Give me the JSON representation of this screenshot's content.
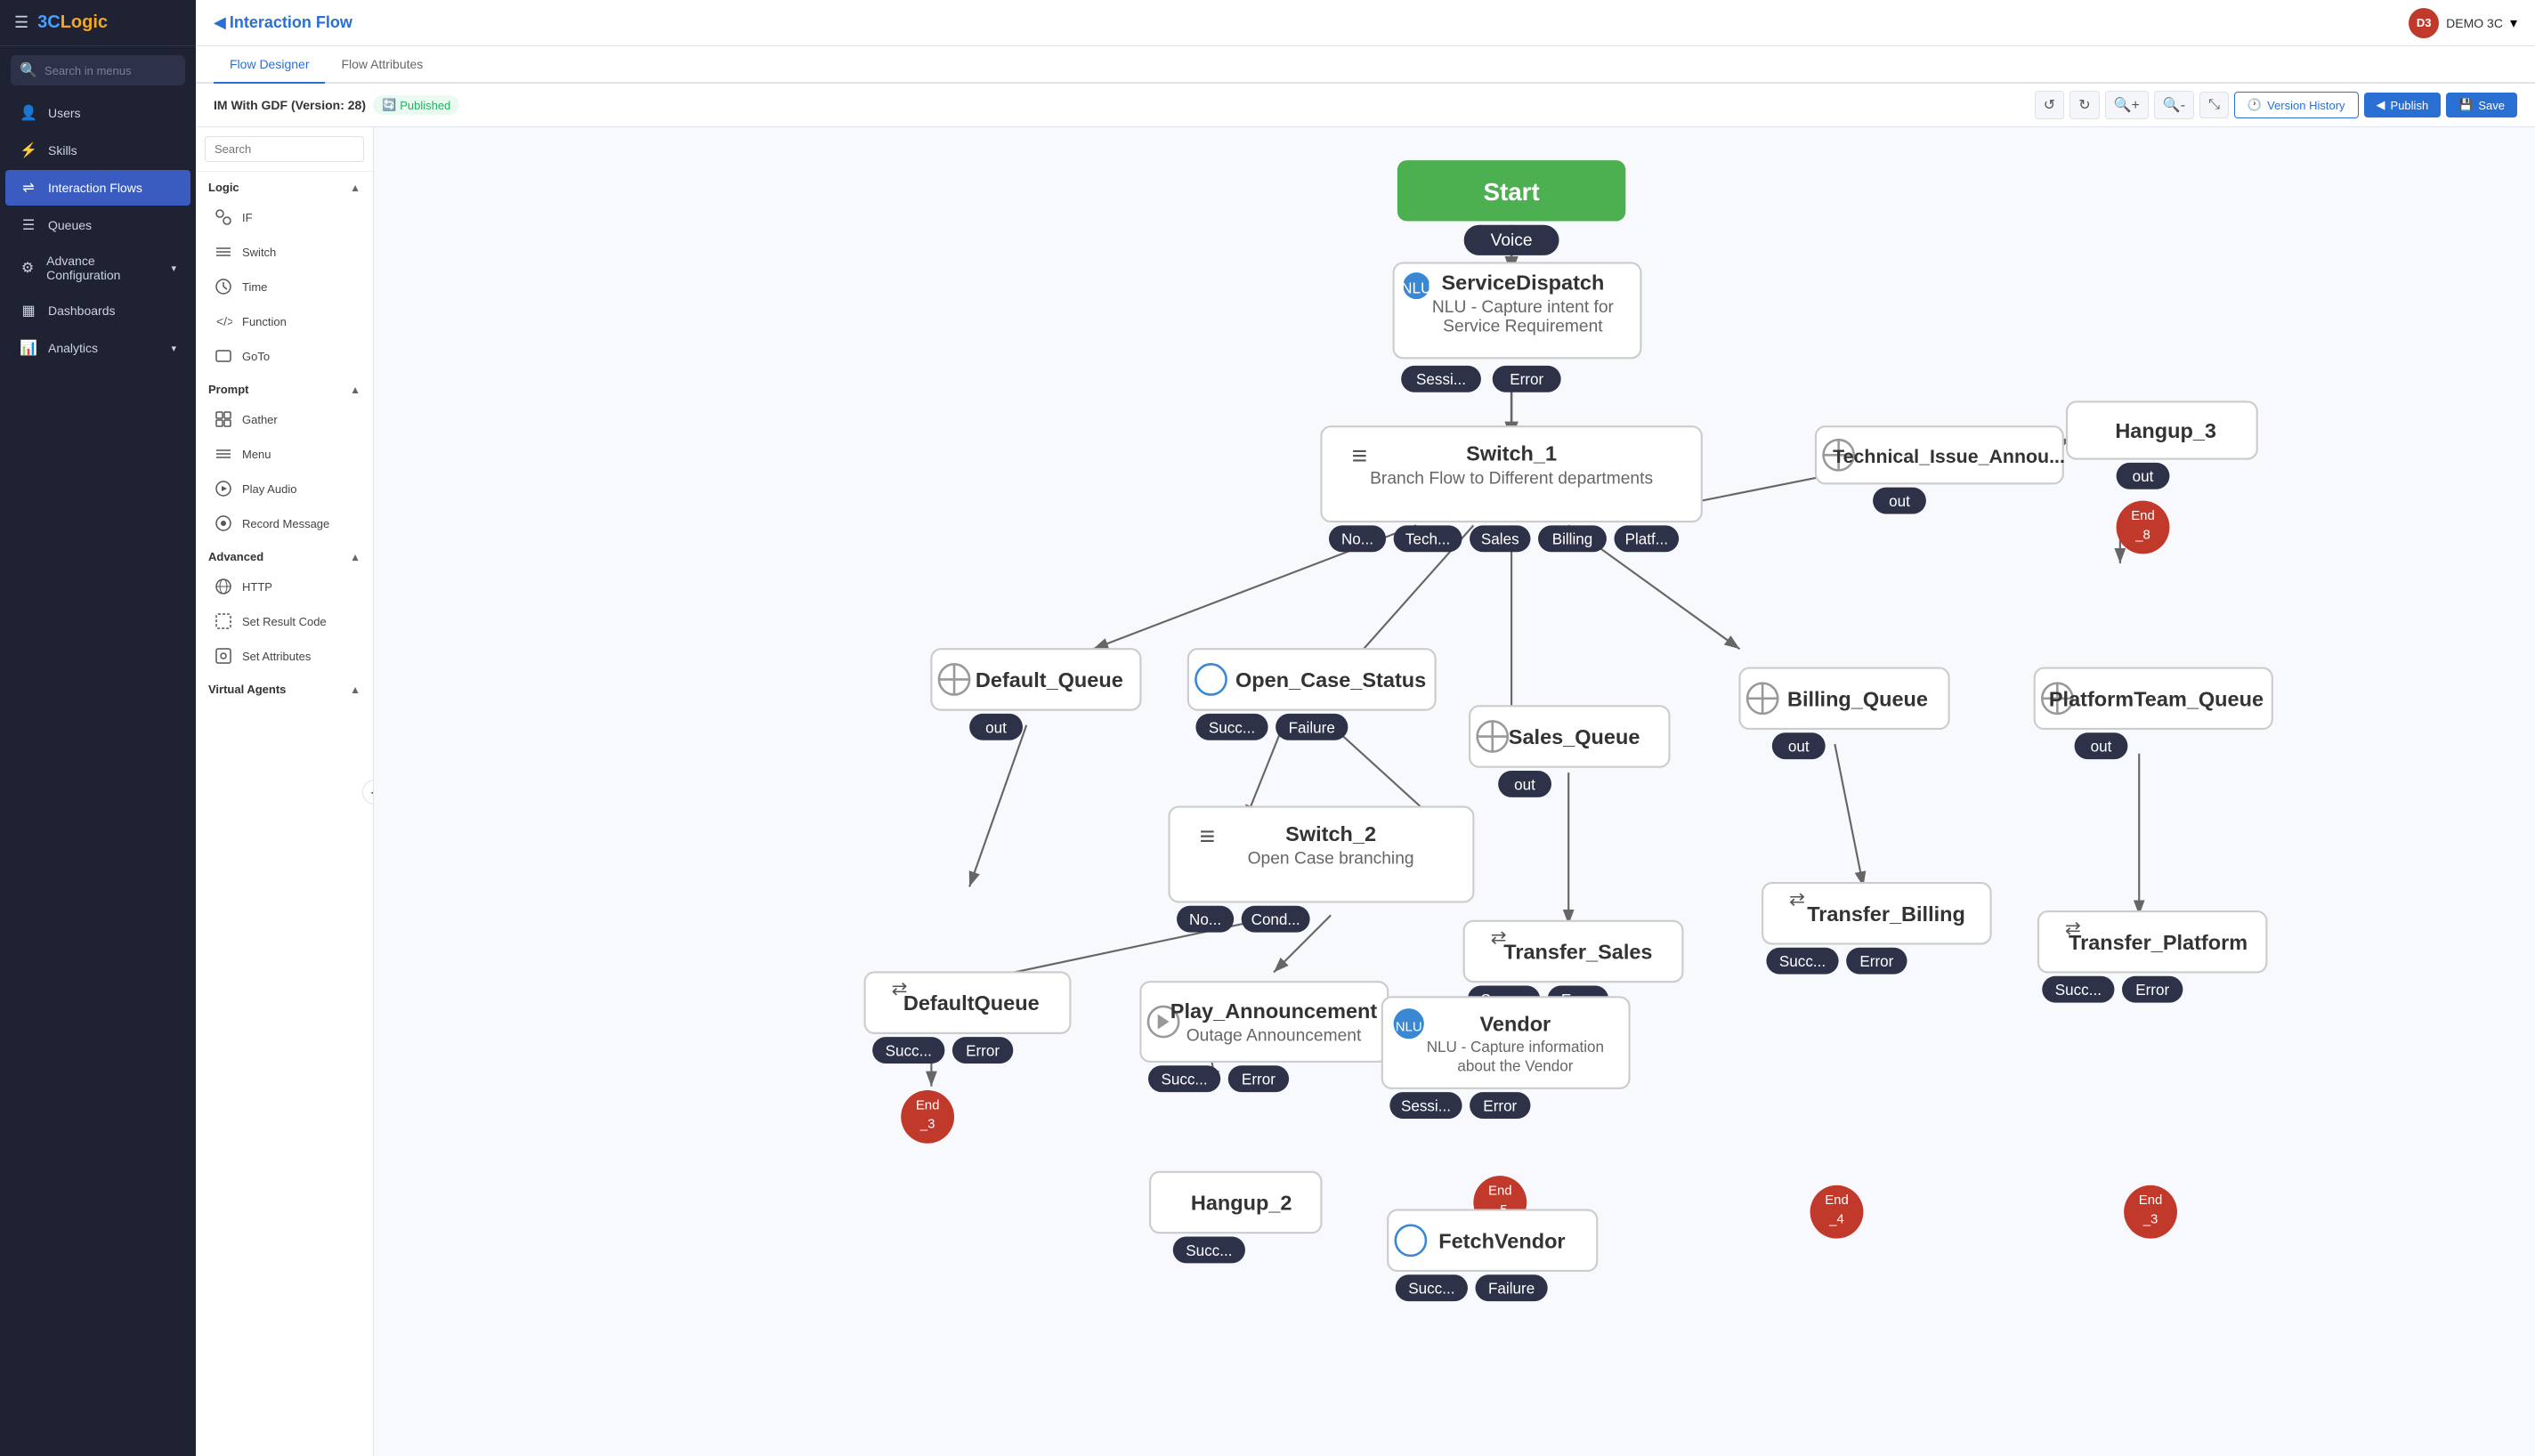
{
  "app": {
    "logo_main": "3C",
    "logo_accent": "Logic",
    "user_initials": "D3",
    "user_name": "DEMO 3C",
    "chevron": "▾"
  },
  "sidebar": {
    "search_placeholder": "Search in menus",
    "nav_items": [
      {
        "id": "users",
        "label": "Users",
        "icon": "👤",
        "active": false,
        "has_chevron": false
      },
      {
        "id": "skills",
        "label": "Skills",
        "icon": "⚡",
        "active": false,
        "has_chevron": false
      },
      {
        "id": "interaction-flows",
        "label": "Interaction Flows",
        "icon": "⇌",
        "active": true,
        "has_chevron": false
      },
      {
        "id": "queues",
        "label": "Queues",
        "icon": "☰",
        "active": false,
        "has_chevron": false
      },
      {
        "id": "advance-config",
        "label": "Advance Configuration",
        "icon": "⚙",
        "active": false,
        "has_chevron": true
      },
      {
        "id": "dashboards",
        "label": "Dashboards",
        "icon": "▦",
        "active": false,
        "has_chevron": false
      },
      {
        "id": "analytics",
        "label": "Analytics",
        "icon": "📊",
        "active": false,
        "has_chevron": true
      }
    ]
  },
  "topbar": {
    "back_icon": "◀",
    "title": "Interaction Flow"
  },
  "tabs": [
    {
      "id": "flow-designer",
      "label": "Flow Designer",
      "active": true
    },
    {
      "id": "flow-attributes",
      "label": "Flow Attributes",
      "active": false
    }
  ],
  "toolbar": {
    "flow_title": "IM With GDF (Version: 28)",
    "published_label": "Published",
    "undo_icon": "↺",
    "redo_icon": "↻",
    "zoom_in_icon": "🔍",
    "zoom_out_icon": "🔍",
    "fit_icon": "⤡",
    "version_history_label": "Version History",
    "publish_label": "Publish",
    "save_label": "Save"
  },
  "left_panel": {
    "search_placeholder": "Search",
    "sections": [
      {
        "id": "logic",
        "title": "Logic",
        "items": [
          {
            "id": "if",
            "label": "IF",
            "icon": "if"
          },
          {
            "id": "switch",
            "label": "Switch",
            "icon": "switch"
          },
          {
            "id": "time",
            "label": "Time",
            "icon": "clock"
          },
          {
            "id": "function",
            "label": "Function",
            "icon": "func"
          },
          {
            "id": "goto",
            "label": "GoTo",
            "icon": "goto"
          }
        ]
      },
      {
        "id": "prompt",
        "title": "Prompt",
        "items": [
          {
            "id": "gather",
            "label": "Gather",
            "icon": "gather"
          },
          {
            "id": "menu",
            "label": "Menu",
            "icon": "menu"
          },
          {
            "id": "play-audio",
            "label": "Play Audio",
            "icon": "play"
          },
          {
            "id": "record-message",
            "label": "Record Message",
            "icon": "record"
          }
        ]
      },
      {
        "id": "advanced",
        "title": "Advanced",
        "items": [
          {
            "id": "http",
            "label": "HTTP",
            "icon": "http"
          },
          {
            "id": "set-result-code",
            "label": "Set Result Code",
            "icon": "result"
          },
          {
            "id": "set-attributes",
            "label": "Set Attributes",
            "icon": "attrs"
          }
        ]
      },
      {
        "id": "virtual-agents",
        "title": "Virtual Agents",
        "items": []
      }
    ]
  },
  "flow_nodes": {
    "start": {
      "label": "Start",
      "badge": "Voice"
    },
    "service_dispatch": {
      "label": "ServiceDispatch",
      "desc": "NLU - Capture intent for Service Requirement",
      "badges": [
        "Sessi...",
        "Error"
      ]
    },
    "technical_issue": {
      "label": "Technical_Issue_Annou...",
      "badge": "out"
    },
    "switch_1": {
      "label": "Switch_1",
      "desc": "Branch Flow to Different departments",
      "badges": [
        "No...",
        "Tech...",
        "Sales",
        "Billing",
        "Platf..."
      ]
    },
    "hangup_3": {
      "label": "Hangup_3",
      "badge": "out"
    },
    "end_8": {
      "label": "End_8"
    },
    "billing_queue": {
      "label": "Billing_Queue",
      "badge": "out"
    },
    "default_queue": {
      "label": "Default_Queue",
      "badge": "out"
    },
    "open_case_status": {
      "label": "Open_Case_Status",
      "badges": [
        "Succ...",
        "Failure"
      ]
    },
    "switch_2": {
      "label": "Switch_2",
      "desc": "Open Case branching",
      "badges": [
        "No...",
        "Cond..."
      ]
    },
    "sales_queue": {
      "label": "Sales_Queue",
      "badge": "out"
    },
    "platform_team_queue": {
      "label": "PlatformTeam_Queue",
      "badge": "out"
    },
    "transfer_billing": {
      "label": "Transfer_Billing",
      "badges": [
        "Succ...",
        "Error"
      ]
    },
    "transfer_platform": {
      "label": "Transfer_Platform",
      "badges": [
        "Succ...",
        "Error"
      ]
    },
    "default_queue2": {
      "label": "DefaultQueue",
      "badges": [
        "Succ...",
        "Error"
      ]
    },
    "play_announcement": {
      "label": "Play_Announcement",
      "desc": "Outage Announcement",
      "badges": [
        "Succ...",
        "Error"
      ]
    },
    "vendor": {
      "label": "Vendor",
      "desc": "NLU - Capture information about the Vendor",
      "badges": [
        "Sessi...",
        "Error"
      ]
    },
    "transfer_sales": {
      "label": "Transfer_Sales",
      "badges": [
        "Succ...",
        "Error"
      ]
    },
    "hangup_2": {
      "label": "Hangup_2",
      "badges": [
        "Succ..."
      ]
    },
    "fetch_vendor": {
      "label": "FetchVendor",
      "badges": [
        "Succ...",
        "Failure"
      ]
    },
    "end_3": {
      "label": "End_3"
    },
    "end_5": {
      "label": "End_5"
    },
    "end_4": {
      "label": "End_4"
    },
    "end_3b": {
      "label": "End_3"
    }
  }
}
